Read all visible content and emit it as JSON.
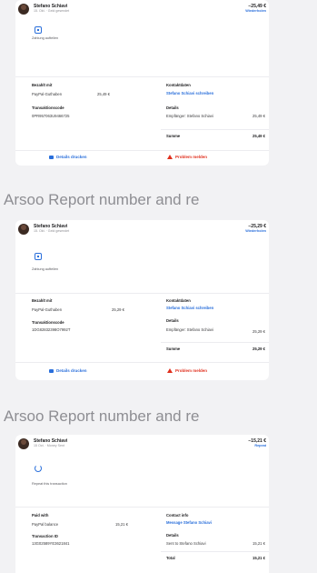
{
  "cards": [
    {
      "name": "Stefano Schiavi",
      "subtitle": "15. Okt. · Geld gesendet",
      "amount": "−25,49 €",
      "repeat": "Wiederholen",
      "action_label": "Zahlung aufteilen",
      "paid_with_label": "Bezahlt mit",
      "paid_with_value": "PayPal-Guthaben",
      "paid_with_amount": "25,49 €",
      "transaction_label": "Transaktionscode",
      "transaction_id": "0PR957063U9466725",
      "contact_label": "Kontaktdaten",
      "contact_link": "Stefano Schiavi schreiben",
      "details_label": "Details",
      "recipient_label": "Empfänger: Stefano Schiavi",
      "recipient_amount": "25,49 €",
      "sum_label": "Summe",
      "sum_amount": "25,49 €",
      "print_label": "Details drucken",
      "problem_label": "Problem melden"
    },
    {
      "name": "Stefano Schiavi",
      "subtitle": "15. Okt. · Geld gesendet",
      "amount": "−25,29 €",
      "repeat": "Wiederholen",
      "action_label": "Zahlung aufteilen",
      "paid_with_label": "Bezahlt mit",
      "paid_with_value": "PayPal-Guthaben",
      "paid_with_amount": "25,29 €",
      "transaction_label": "Transaktionscode",
      "transaction_id": "1DG82832398O7992T",
      "contact_label": "Kontaktdaten",
      "contact_link": "Stefano Schiavi schreiben",
      "details_label": "Details",
      "recipient_label": "Empfänger: Stefano Schiavi",
      "recipient_amount": "25,29 €",
      "sum_label": "Summe",
      "sum_amount": "25,29 €",
      "print_label": "Details drucken",
      "problem_label": "Problem melden"
    },
    {
      "name": "Stefano Schiavi",
      "subtitle": "15 Oct. · Money Sent",
      "amount": "−15,21 €",
      "repeat": "Repeat",
      "action_label": "Repeat this transaction",
      "paid_with_label": "Paid with",
      "paid_with_value": "PayPal balance",
      "paid_with_amount": "15,21 €",
      "transaction_label": "Transaction ID",
      "transaction_id": "13G02589YE3621841",
      "contact_label": "Contact info",
      "contact_link": "Message Stefano Schiavi",
      "details_label": "Details",
      "recipient_label": "Sent to Stefano Schiavi",
      "recipient_amount": "15,21 €",
      "sum_label": "Total",
      "sum_amount": "15,21 €"
    }
  ],
  "section_headers": [
    "Arsoo   Report number and re",
    "Arsoo   Report number and re"
  ]
}
